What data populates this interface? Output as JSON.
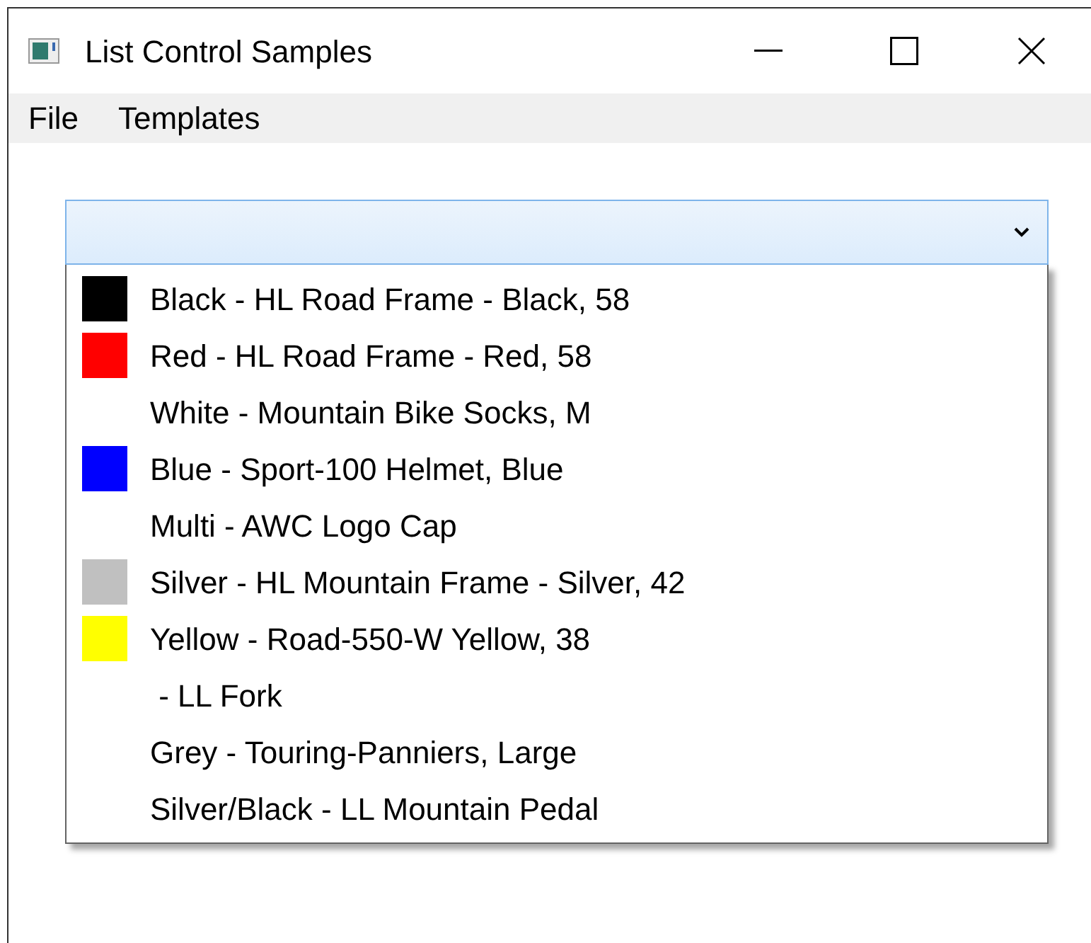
{
  "window": {
    "title": "List Control Samples"
  },
  "menu": [
    "File",
    "Templates"
  ],
  "combo": {
    "expanded": true
  },
  "items": [
    {
      "label": "Black - HL Road Frame - Black, 58",
      "color": "#000000"
    },
    {
      "label": "Red - HL Road Frame - Red, 58",
      "color": "#ff0000"
    },
    {
      "label": "White - Mountain Bike Socks, M"
    },
    {
      "label": "Blue - Sport-100 Helmet, Blue",
      "color": "#0000ff"
    },
    {
      "label": "Multi - AWC Logo Cap"
    },
    {
      "label": "Silver - HL Mountain Frame - Silver, 42",
      "color": "#c0c0c0"
    },
    {
      "label": "Yellow - Road-550-W Yellow, 38",
      "color": "#ffff00"
    },
    {
      "label": " - LL Fork"
    },
    {
      "label": "Grey - Touring-Panniers, Large"
    },
    {
      "label": "Silver/Black - LL Mountain Pedal"
    }
  ]
}
